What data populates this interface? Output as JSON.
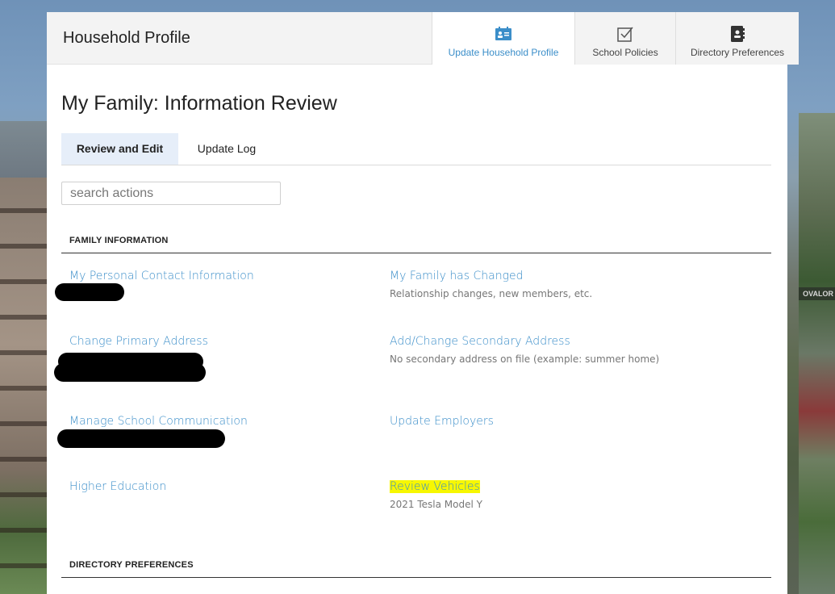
{
  "header": {
    "title": "Household Profile",
    "tabs": [
      {
        "label": "Update Household Profile",
        "icon": "id-card-icon",
        "active": true
      },
      {
        "label": "School Policies",
        "icon": "checkbox-icon",
        "active": false
      },
      {
        "label": "Directory Preferences",
        "icon": "address-book-icon",
        "active": false
      }
    ]
  },
  "main": {
    "title": "My Family: Information Review",
    "subtabs": [
      {
        "label": "Review and Edit",
        "active": true
      },
      {
        "label": "Update Log",
        "active": false
      }
    ],
    "search": {
      "placeholder": "search actions",
      "value": ""
    }
  },
  "sections": [
    {
      "label": "FAMILY INFORMATION",
      "items": [
        {
          "label": "My Personal Contact Information",
          "desc": ""
        },
        {
          "label": "My Family has Changed",
          "desc": "Relationship changes, new members, etc."
        },
        {
          "label": "Change Primary Address",
          "desc": ""
        },
        {
          "label": "Add/Change Secondary Address",
          "desc": "No secondary address on file (example: summer home)"
        },
        {
          "label": "Manage School Communication",
          "desc": ""
        },
        {
          "label": "Update Employers",
          "desc": ""
        },
        {
          "label": "Higher Education",
          "desc": ""
        },
        {
          "label": "Review Vehicles",
          "desc": "2021 Tesla Model Y",
          "highlighted": true
        }
      ]
    },
    {
      "label": "DIRECTORY PREFERENCES"
    }
  ],
  "background": {
    "sign_text": "OVALOR"
  },
  "colors": {
    "accent": "#3b8ec9",
    "highlight": "#f7f700",
    "active_subtab": "#e6eef9"
  }
}
